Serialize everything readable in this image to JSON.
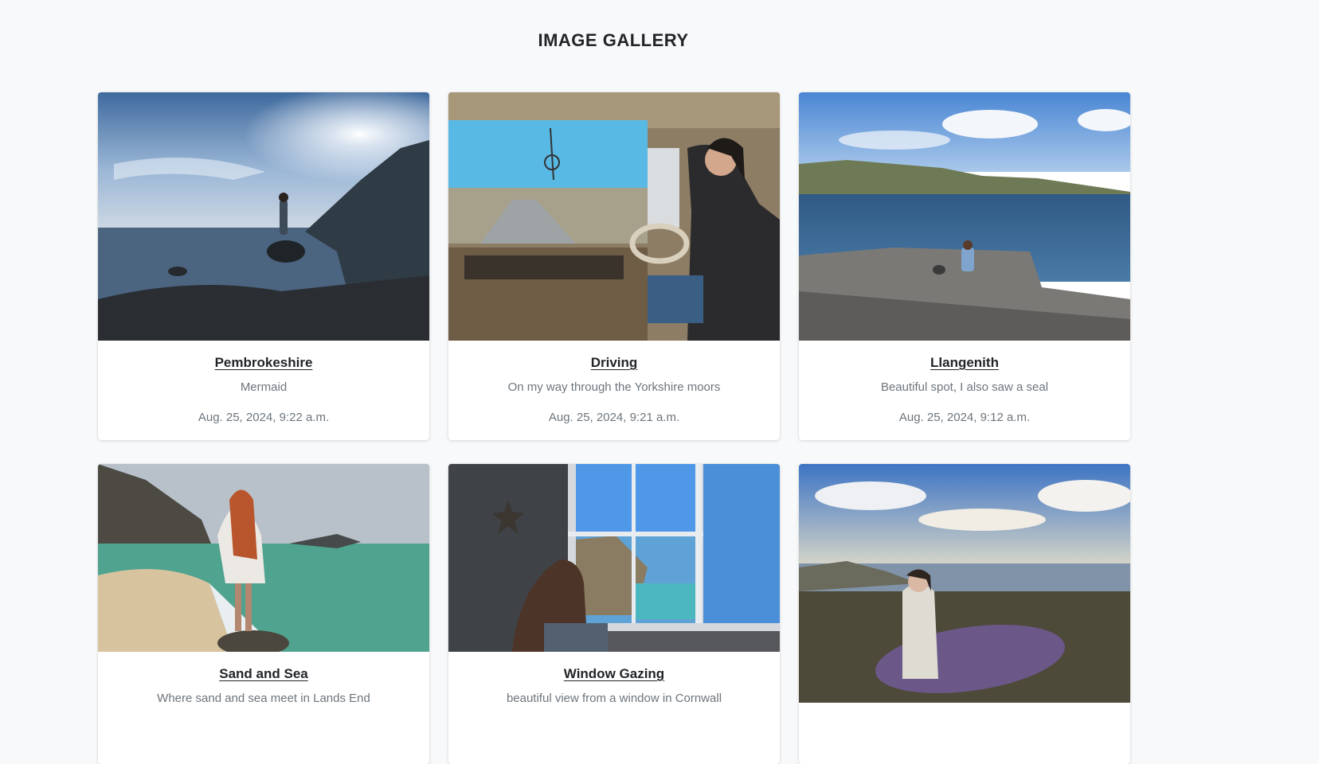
{
  "page": {
    "title": "IMAGE GALLERY"
  },
  "gallery": {
    "cards": [
      {
        "title": "Pembrokeshire",
        "description": "Mermaid",
        "date": "Aug. 25, 2024, 9:22 a.m.",
        "photo": "woman-standing-on-rock-by-sea-with-sun-flare"
      },
      {
        "title": "Driving",
        "description": "On my way through the Yorkshire moors",
        "date": "Aug. 25, 2024, 9:21 a.m.",
        "photo": "woman-driving-vintage-van"
      },
      {
        "title": "Llangenith",
        "description": "Beautiful spot, I also saw a seal",
        "date": "Aug. 25, 2024, 9:12 a.m.",
        "photo": "woman-sitting-on-rocky-coast"
      },
      {
        "title": "Sand and Sea",
        "description": "Where sand and sea meet in Lands End",
        "date": "",
        "photo": "woman-on-rock-at-beach"
      },
      {
        "title": "Window Gazing",
        "description": "beautiful view from a window in Cornwall",
        "date": "",
        "photo": "woman-looking-out-window-at-coast"
      },
      {
        "title": "",
        "description": "",
        "date": "",
        "photo": "woman-holding-purple-surfboard-on-cliff"
      }
    ]
  },
  "colors": {
    "background": "#f8f9fa",
    "text": "#212529",
    "muted": "#6c757d"
  }
}
